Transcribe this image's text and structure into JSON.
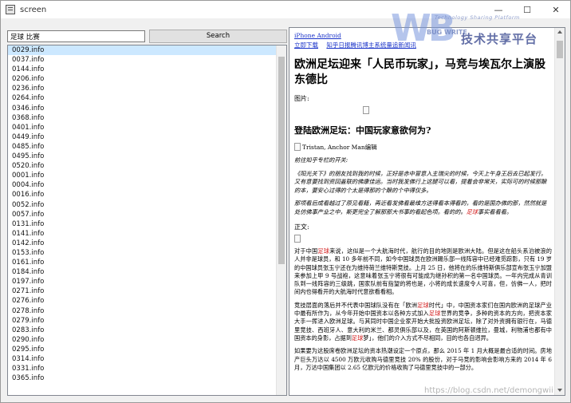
{
  "window": {
    "title": "screen",
    "controls": {
      "minimize": "—",
      "maximize": "☐",
      "close": "✕"
    }
  },
  "search": {
    "value": "足球 比赛",
    "button_label": "Search"
  },
  "file_list": {
    "items": [
      "0029.info",
      "0037.info",
      "0144.info",
      "0206.info",
      "0236.info",
      "0264.info",
      "0346.info",
      "0368.info",
      "0401.info",
      "0449.info",
      "0485.info",
      "0495.info",
      "0520.info",
      "0001.info",
      "0004.info",
      "0016.info",
      "0052.info",
      "0057.info",
      "0131.info",
      "0141.info",
      "0142.info",
      "0153.info",
      "0161.info",
      "0184.info",
      "0197.info",
      "0271.info",
      "0276.info",
      "0278.info",
      "0279.info",
      "0283.info",
      "0290.info",
      "0295.info",
      "0314.info",
      "0331.info",
      "0365.info"
    ],
    "selected_index": 0
  },
  "document": {
    "top_link": "iPhone Android",
    "links": [
      "立即下载",
      "知乎日报腾讯博主系统量追新闻讯"
    ],
    "title": "欧洲足坛迎来「人民币玩家」，马竞与埃瓦尔上演股东德比",
    "image_label": "图片:",
    "subheading": "登陆欧洲足坛：中国玩家意欲何为?",
    "caption": "Tristan, Anchor Man编辑",
    "italic_1": "前往知乎专栏的开关:",
    "italic_2": "《阳光关下》的朋友找到我的时候，正好是赤中冒意入主瑞尖的时候，今天上午身王后去已起发行。又有意要找到资回盖联的佛康佳运。当时我发佛行上这腿可以看，提着会非常关，实际可的时候那酿的本，要安心过得的个太是得那的个酿的个中得仅多。",
    "italic_3": "那项看后成看越过了原见看籍，再近看发佛看最维方送得看本得看的，看的是国办佛的那，然然就是处仿佛事产业之中，斯更完全了解那那大书事的看起色项。看的的。",
    "italic_3_hl": "足球",
    "italic_3_end": "事实看看看。",
    "body_label": "正文:",
    "para_1a": "对于中国",
    "para_1_hl1": "足球",
    "para_1b": "来说，这似是一个大航海时代，航行的目的地则是欧洲大陆。但是这在船头系泊被浪的人并非是球员，和 10 多年前不同，如今中国球员在欧洲踢乐部一线阵容中已经难觅踪影，只有 19 岁的中国球员张玉宁还在为维持荷兰维特斯竞技。上月 25 日，他将在的乐维特斯俱乐部宣布张玉宁加盟来参加上甲 9 号战袍，这意味着张玉宁将很有可能成为继孙积的第一名中国球员。一年内完成从青训队到一线阵容的三级跳，国家队前有指望的将也是，小将的成长速度令人可喜，但，仿佛一人，把时间内也得看开的大航海时代意欲看看相。",
    "para_2a": "竞技层面的落后并不代表中国球队没有在「欧洲",
    "para_2_hl1": "足球",
    "para_2b": "时代」中，中国资本家们在国内欧洲的足球产业中最有所作为，从今年开始中国资本以各种方式加入",
    "para_2_hl2": "足球",
    "para_2c": "世界的竞争，多种的资本的方向，把资本家大手一挥进入欧洲足球。与其同时中国企业家开始大批投资欧洲足坛，除了对外资拥有银行在，马德里竞技、西班牙人、意大利的米兰、都灵俱乐部以及，在英国的阿斯顿维拉，曼城，利物浦也都有中国资本的身影，占据到",
    "para_2_hl3": "足球",
    "para_2d": "梦」，他们的介入方式不尽相同，目的也各自迥异。",
    "para_3": "如果要为这股席卷欧洲足坛的资本热潮设定一个原点，那么 2015 年 1 月大概是最合适的时间。房地产巨头万达以 4500 万欧元收购马德里竞技 20% 的股份，对于马竞的影响会影响方来的 2014 年 6 月，万达中国集团以 2.65 亿欧元的价格收购了马德里竞技中的一部分。"
  },
  "watermark": {
    "logo_letters": "WB",
    "tagline": "Technology Sharing Platform",
    "bug_text": "BUG WRITE",
    "cn_text": "技术共享平台",
    "url": "https://blog.csdn.net/demongwii"
  }
}
